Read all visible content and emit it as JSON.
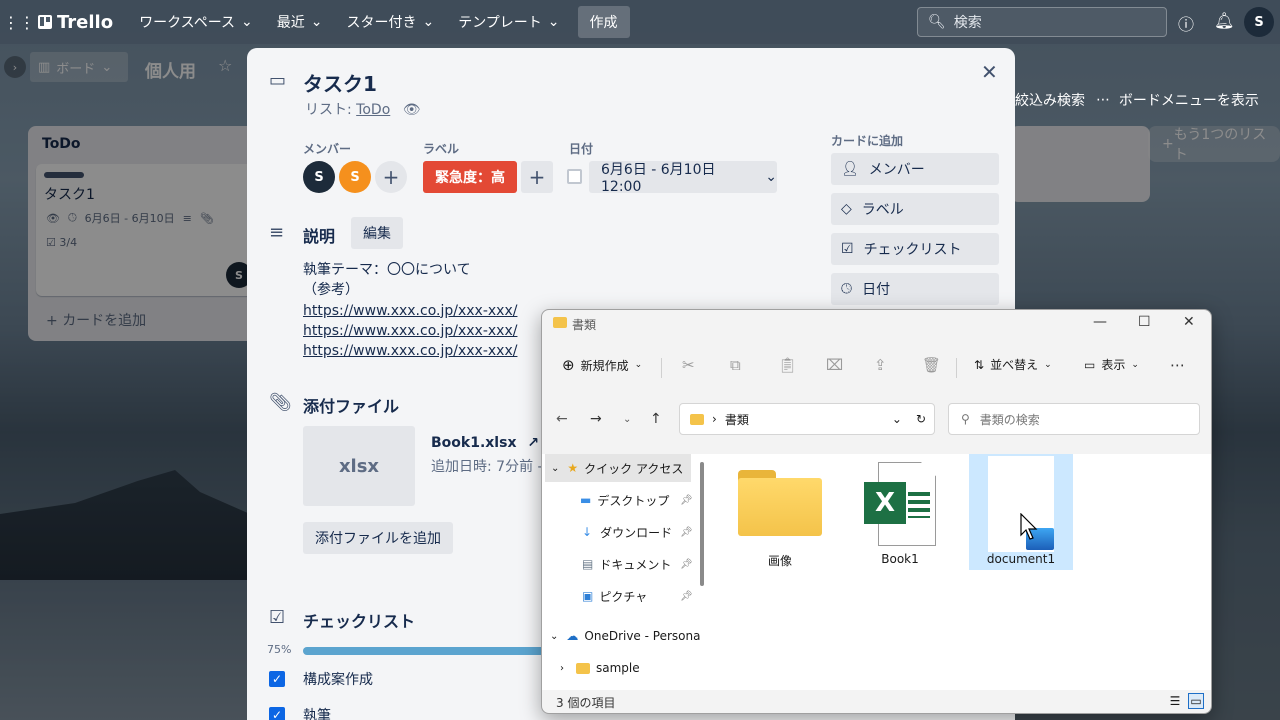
{
  "topbar": {
    "app_name": "Trello",
    "nav": [
      "ワークスペース",
      "最近",
      "スター付き",
      "テンプレート"
    ],
    "create_label": "作成",
    "search_placeholder": "検索",
    "user_initial": "S"
  },
  "board": {
    "view_label": "ボード",
    "title": "個人用",
    "filter_label": "絞込み検索",
    "menu_label": "ボードメニューを表示",
    "add_list_label": "もう1つのリスト"
  },
  "list": {
    "title": "ToDo",
    "card_title": "タスク1",
    "card_dates": "6月6日 - 6月10日",
    "card_checklist": "3/4",
    "add_card_label": "カードを追加",
    "card_avatar": "S"
  },
  "modal": {
    "title": "タスク1",
    "list_prefix": "リスト: ",
    "list_name": "ToDo",
    "members_label": "メンバー",
    "members": [
      {
        "initial": "S",
        "color": "#1d2b3a"
      },
      {
        "initial": "S",
        "color": "#f5901d"
      }
    ],
    "labels_label": "ラベル",
    "label_chip": "緊急度：高",
    "date_label": "日付",
    "date_value": "6月6日 - 6月10日 12:00",
    "desc_title": "説明",
    "edit_label": "編集",
    "desc_lines": [
      "執筆テーマ：〇〇について",
      "（参考）"
    ],
    "desc_links": [
      "https://www.xxx.co.jp/xxx-xxx/",
      "https://www.xxx.co.jp/xxx-xxx/",
      "https://www.xxx.co.jp/xxx-xxx/"
    ],
    "attachments_title": "添付ファイル",
    "attachment_ext": "xlsx",
    "attachment_name": "Book1.xlsx",
    "attachment_meta": "追加日時: 7分前 -",
    "add_attachment_label": "添付ファイルを追加",
    "checklist_title": "チェックリスト",
    "checklist_percent": "75%",
    "checklist_progress": 0.75,
    "checklist_items": [
      "構成案作成",
      "執筆"
    ],
    "add_to_card_label": "カードに追加",
    "side_buttons": [
      "メンバー",
      "ラベル",
      "チェックリスト",
      "日付"
    ]
  },
  "explorer": {
    "title": "書類",
    "toolbar": {
      "new_label": "新規作成",
      "sort_label": "並べ替え",
      "view_label": "表示"
    },
    "address": "書類",
    "search_placeholder": "書類の検索",
    "nav": [
      {
        "label": "クイック アクセス"
      },
      {
        "label": "デスクトップ"
      },
      {
        "label": "ダウンロード"
      },
      {
        "label": "ドキュメント"
      },
      {
        "label": "ピクチャ"
      },
      {
        "label": "OneDrive - Persona"
      },
      {
        "label": "sample"
      }
    ],
    "items": [
      {
        "label": "画像"
      },
      {
        "label": "Book1"
      },
      {
        "label": "document1"
      }
    ],
    "status": "3 個の項目"
  }
}
